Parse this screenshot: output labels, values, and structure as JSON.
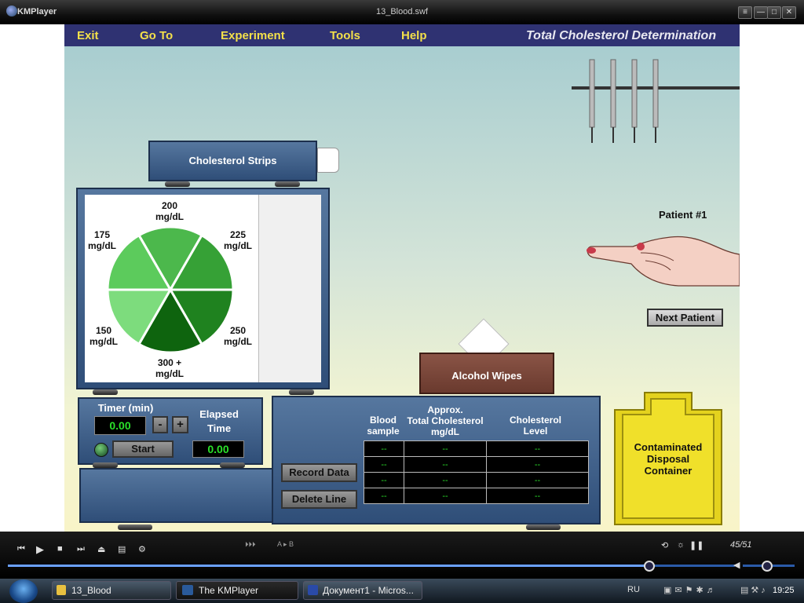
{
  "window": {
    "app_name": "KMPlayer",
    "file_name": "13_Blood.swf",
    "btn_menu": "≡",
    "btn_min": "—",
    "btn_max": "□",
    "btn_close": "✕"
  },
  "menu": {
    "items": [
      "Exit",
      "Go To",
      "Experiment",
      "Tools",
      "Help"
    ],
    "title": "Total Cholesterol Determination"
  },
  "strips": {
    "label": "Cholesterol Strips"
  },
  "chart": {
    "labels": {
      "s150": [
        "150",
        "mg/dL"
      ],
      "s175": [
        "175",
        "mg/dL"
      ],
      "s200": [
        "200",
        "mg/dL"
      ],
      "s225": [
        "225",
        "mg/dL"
      ],
      "s250": [
        "250",
        "mg/dL"
      ],
      "s300": [
        "300 +",
        "mg/dL"
      ]
    },
    "colors": {
      "s150": "#7ddc7d",
      "s175": "#5ccb5c",
      "s200": "#4cb84c",
      "s225": "#36a136",
      "s250": "#1f821f",
      "s300": "#0e640e"
    }
  },
  "timer": {
    "label": "Timer (min)",
    "value": "0.00",
    "minus": "-",
    "plus": "+",
    "start": "Start",
    "elapsed_label": [
      "Elapsed",
      "Time"
    ],
    "elapsed_value": "0.00"
  },
  "table": {
    "headers": [
      [
        "Blood",
        "sample"
      ],
      [
        "Approx.",
        "Total Cholesterol",
        "mg/dL"
      ],
      [
        "Cholesterol",
        "Level"
      ]
    ],
    "rows": [
      [
        "--",
        "--",
        "--"
      ],
      [
        "--",
        "--",
        "--"
      ],
      [
        "--",
        "--",
        "--"
      ],
      [
        "--",
        "--",
        "--"
      ]
    ],
    "record": "Record Data",
    "delete": "Delete Line"
  },
  "wipes": {
    "label": "Alcohol Wipes"
  },
  "disposal": {
    "label": [
      "Contaminated",
      "Disposal",
      "Container"
    ]
  },
  "patient": {
    "label": "Patient #1",
    "next": "Next Patient"
  },
  "player": {
    "counter": "45/51",
    "ab_label": "A ▸ B"
  },
  "taskbar": {
    "items": [
      "13_Blood",
      "The KMPlayer",
      "Документ1 - Micros..."
    ],
    "lang": "RU",
    "clock": "19:25"
  }
}
